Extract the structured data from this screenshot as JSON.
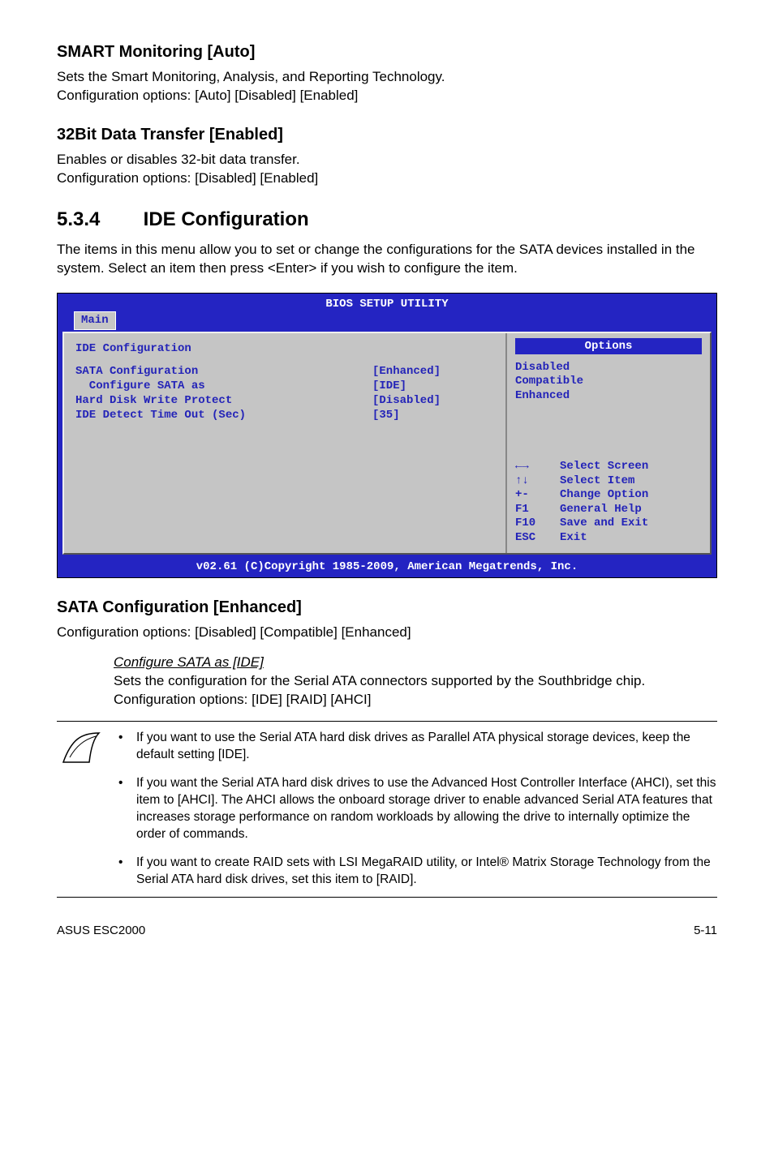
{
  "sec1": {
    "heading": "SMART Monitoring [Auto]",
    "p1": "Sets the Smart Monitoring, Analysis, and Reporting Technology.",
    "p2": "Configuration options: [Auto] [Disabled] [Enabled]"
  },
  "sec2": {
    "heading": "32Bit Data Transfer [Enabled]",
    "p1": "Enables or disables 32-bit data transfer.",
    "p2": "Configuration options: [Disabled] [Enabled]"
  },
  "sec3": {
    "num": "5.3.4",
    "title": "IDE Configuration",
    "intro": "The items in this menu allow you to set or change the configurations for the SATA devices installed in the system. Select an item then press <Enter> if you wish to configure the item."
  },
  "bios": {
    "title": "BIOS SETUP UTILITY",
    "tab": "Main",
    "panel_heading": "IDE Configuration",
    "rows": [
      {
        "label": "SATA Configuration",
        "value": "[Enhanced]"
      },
      {
        "label": "  Configure SATA as",
        "value": "[IDE]"
      },
      {
        "label": "",
        "value": ""
      },
      {
        "label": "Hard Disk Write Protect",
        "value": "[Disabled]"
      },
      {
        "label": "IDE Detect Time Out (Sec)",
        "value": "[35]"
      }
    ],
    "options_header": "Options",
    "options": [
      "Disabled",
      "Compatible",
      "Enhanced"
    ],
    "help": [
      {
        "key": "←→",
        "text": "Select Screen"
      },
      {
        "key": "↑↓",
        "text": "Select Item"
      },
      {
        "key": "+-",
        "text": "Change Option"
      },
      {
        "key": "F1",
        "text": "General Help"
      },
      {
        "key": "F10",
        "text": "Save and Exit"
      },
      {
        "key": "ESC",
        "text": "Exit"
      }
    ],
    "footer": "v02.61 (C)Copyright 1985-2009, American Megatrends, Inc."
  },
  "sec4": {
    "heading": "SATA Configuration [Enhanced]",
    "p1": "Configuration options: [Disabled] [Compatible] [Enhanced]",
    "sub_heading": "Configure SATA as [IDE]",
    "sub_p": "Sets the configuration for the Serial ATA connectors supported by the Southbridge chip. Configuration options: [IDE] [RAID] [AHCI]"
  },
  "notes": {
    "items": [
      "If you want to use the Serial ATA hard disk drives as Parallel ATA physical storage devices, keep the default setting [IDE].",
      "If you want the Serial ATA hard disk drives to use the Advanced Host Controller Interface (AHCI), set this item to [AHCI]. The AHCI allows the onboard storage driver to enable advanced Serial ATA features that increases storage performance on random workloads by allowing the drive to internally optimize the order of commands.",
      "If you want to create RAID sets with LSI MegaRAID utility, or Intel® Matrix Storage Technology from the Serial ATA hard disk drives, set this item to [RAID]."
    ]
  },
  "footer": {
    "left": "ASUS ESC2000",
    "right": "5-11"
  }
}
